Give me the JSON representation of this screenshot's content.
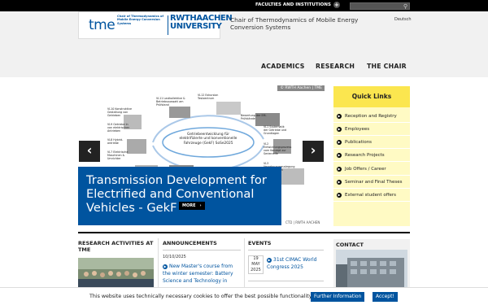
{
  "topbar": {
    "faculties_label": "FACULTIES AND INSTITUTIONS",
    "plus_icon": "plus-icon",
    "search_placeholder": ""
  },
  "logo": {
    "tme": "tme",
    "tme_sub": "Chair of Thermodynamics of Mobile Energy Conversion Systems",
    "rwth_line1": "RWTHAACHEN",
    "rwth_line2": "UNIVERSITY"
  },
  "header": {
    "chair_title": "Chair of Thermodynamics of Mobile Energy Conversion Systems",
    "language": "Deutsch"
  },
  "nav": {
    "items": [
      "ACADEMICS",
      "RESEARCH",
      "THE CHAIR"
    ]
  },
  "carousel": {
    "copyright": "© RWTH Aachen | TME",
    "center_label": "Getriebeentwicklung für elektrifizierte und konventionelle Fahrzeuge (GekF) SoSe2025",
    "caption": "Transmission Development for Electrified and Conventional Vehicles - GekF",
    "more_label": "MORE",
    "prev_icon": "‹",
    "next_icon": "›",
    "diagram_labels": {
      "vl10": "VL10 Konstruktive Gestaltung von Getrieben",
      "vl11": "VL11 Lastkollektive & Betriebsauswahl am Prüfstand",
      "vl12": "VL12 Exkursion Testzentrum",
      "vl9": "VL9 Getriebe in von elektrischen Antrieben",
      "vl8": "VL8 Hybrid-antriebe",
      "vl7": "VL7 Elektrische Maschinen & Umrichter",
      "vl1": "VL1 Systematik der Getriebe und Grundlagen",
      "vl2": "VL2 Entwicklungsprozess vom Konzept zur Serienreife",
      "vl3": "VL3 Verzahnungsauslegung und -festigkeit",
      "bewertung": "Bewertung der EM-Prüfstände"
    },
    "logos_strip": "CTD | RWTH AACHEN"
  },
  "quick_links": {
    "title": "Quick Links",
    "items": [
      "Reception and Registry",
      "Employees",
      "Publications",
      "Research Projects",
      "Job Offers / Career",
      "Seminar and Final Theses",
      "External student offers"
    ]
  },
  "sections": {
    "research_title": "RESEARCH ACTIVITIES AT TME",
    "announcements_title": "ANNOUNCEMENTS",
    "events_title": "EVENTS",
    "contact_title": "CONTACT"
  },
  "announcement": {
    "date": "10/10/2025",
    "text": "New Master's course from the winter semester: Battery Science and Technology in"
  },
  "event": {
    "day": "19",
    "month": "MAY",
    "year": "2025",
    "text": "31st CIMAC World Congress 2025"
  },
  "cookie": {
    "text": "This website uses technically necessary cookies to offer the best possible functionality.",
    "info_label": "Further Information",
    "accept_label": "Accept!"
  },
  "colors": {
    "rwth_blue": "#00549f",
    "quicklinks_yellow": "#fbe64f",
    "quicklinks_bg": "#fffac4"
  }
}
